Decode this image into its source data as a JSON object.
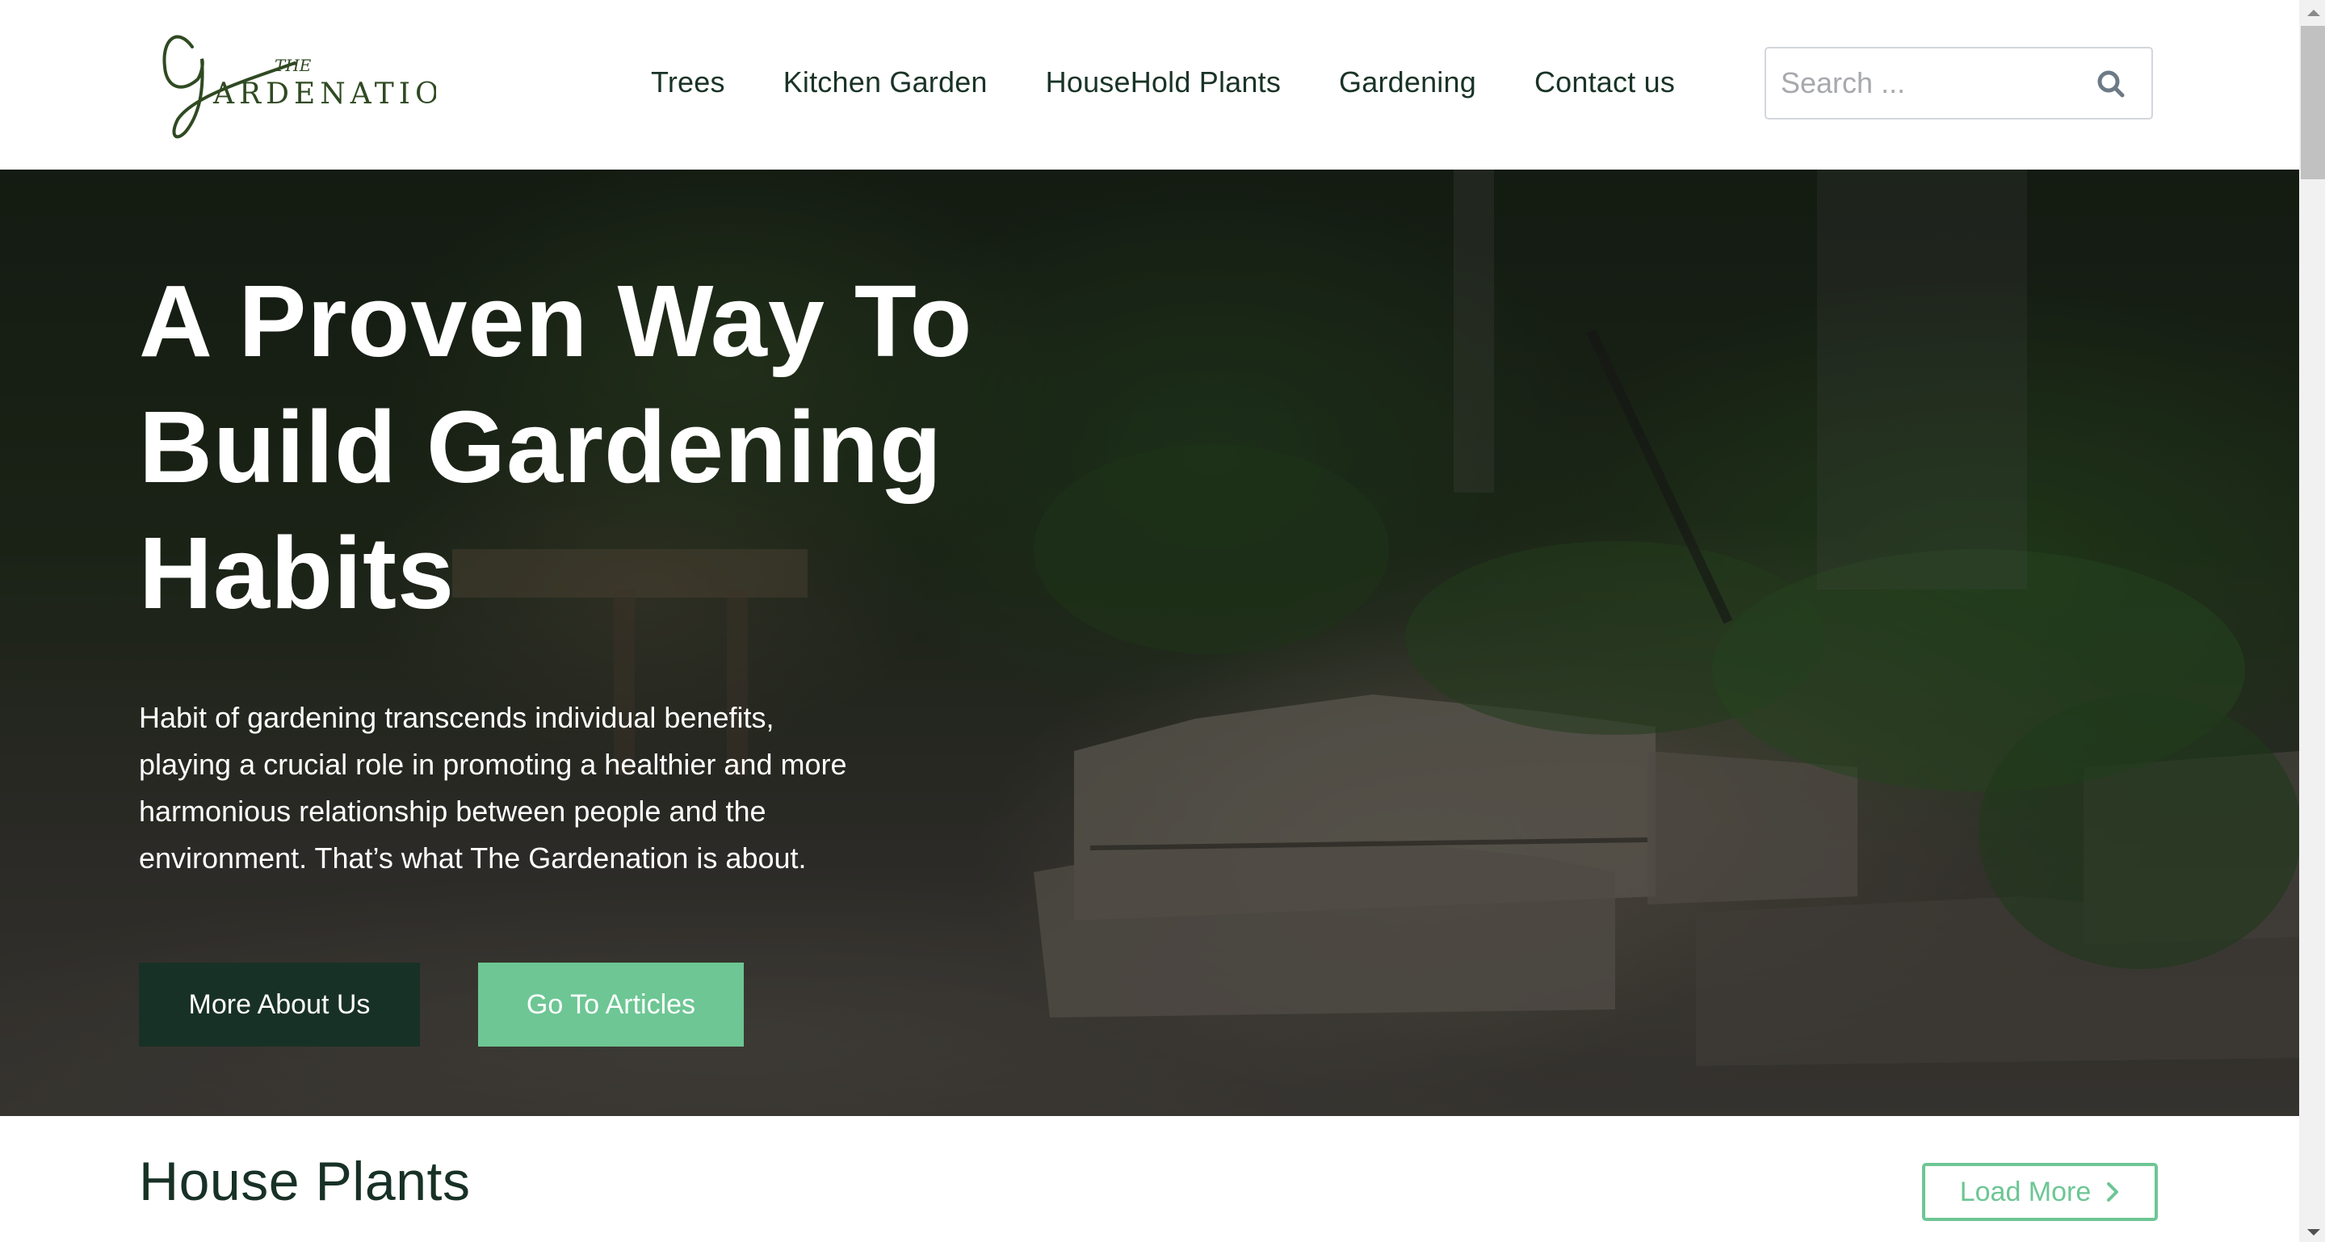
{
  "brand": {
    "logo_small": "THE",
    "logo_main": "ARDENATION",
    "logo_initial": "G",
    "logo_color": "#2f4a22"
  },
  "nav": {
    "items": [
      {
        "label": "Trees"
      },
      {
        "label": "Kitchen Garden"
      },
      {
        "label": "HouseHold Plants"
      },
      {
        "label": "Gardening"
      },
      {
        "label": "Contact us"
      }
    ]
  },
  "search": {
    "placeholder": "Search ...",
    "value": "",
    "icon": "search-icon"
  },
  "hero": {
    "title_lines": [
      "A Proven Way To",
      "Build Gardening",
      "Habits"
    ],
    "description_lines": [
      "Habit of gardening transcends individual benefits,",
      "playing a crucial role in promoting a healthier and more",
      "harmonious relationship between people and the",
      "environment. That’s what The Gardenation is about."
    ],
    "primary_button": "More About Us",
    "secondary_button": "Go To Articles"
  },
  "section": {
    "title": "House Plants",
    "load_more": "Load More",
    "load_more_icon": "chevron-right-icon"
  },
  "colors": {
    "dark_green": "#183126",
    "accent_green": "#6dc694",
    "nav_text": "#1a3327"
  }
}
